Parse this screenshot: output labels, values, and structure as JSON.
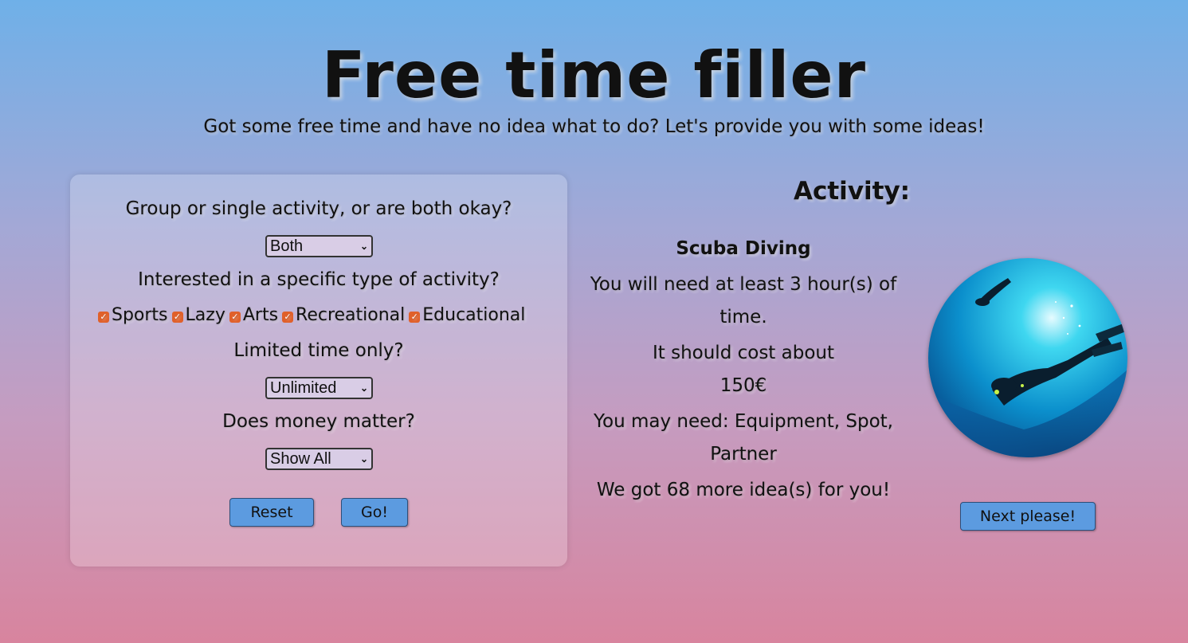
{
  "header": {
    "title": "Free time filler",
    "subtitle": "Got some free time and have no idea what to do? Let's provide you with some ideas!"
  },
  "filters": {
    "group_question": "Group or single activity, or are both okay?",
    "group_select": "Both",
    "type_question": "Interested in a specific type of activity?",
    "types": [
      {
        "label": "Sports",
        "checked": true
      },
      {
        "label": "Lazy",
        "checked": true
      },
      {
        "label": "Arts",
        "checked": true
      },
      {
        "label": "Recreational",
        "checked": true
      },
      {
        "label": "Educational",
        "checked": true
      }
    ],
    "time_question": "Limited time only?",
    "time_select": "Unlimited",
    "money_question": "Does money matter?",
    "money_select": "Show All",
    "reset_label": "Reset",
    "go_label": "Go!"
  },
  "activity": {
    "heading": "Activity:",
    "name": "Scuba Diving",
    "time_text": "You will need at least 3 hour(s) of time.",
    "cost_line1": "It should cost about",
    "cost_line2": "150€",
    "needs_text": "You may need: Equipment, Spot, Partner",
    "more_text": "We got 68 more idea(s) for you!",
    "next_label": "Next please!"
  },
  "colors": {
    "button": "#5c9be0",
    "checkbox": "#e0602a",
    "bg_top": "#6fb0e8",
    "bg_bottom": "#d8849e"
  }
}
